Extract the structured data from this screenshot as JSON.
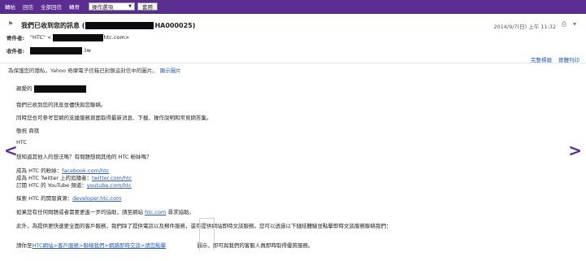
{
  "toolbar": {
    "reply": "轉帖",
    "reply_all": "回信",
    "forward_all": "全部回信",
    "forward": "轉寄",
    "actions_select": "操作選項",
    "apply": "套用"
  },
  "message": {
    "subject_prefix": "我們已收到您的訊息 (",
    "subject_suffix": "HA000025)",
    "datetime": "2014/9/7(日) 上午 11:32",
    "from_label": "寄件者:",
    "from_value_prefix": "\"HTC\" <",
    "from_value_suffix": "htc.com>",
    "to_label": "收件者:",
    "to_value_suffix": ".tw",
    "header_links": [
      "完整標頭",
      "實體列印"
    ],
    "privacy_text": "為保護您的隱私，Yahoo 奇摩電子信箱已封鎖這封信中的圖片。",
    "privacy_link": "顯示圖片"
  },
  "body": {
    "greeting": "親愛的",
    "p1": "我們已收到您的訊息並儘快與您聯絡。",
    "p2": "同時您也可參考官網的支援服務頁面取得最新消息、下載、操作說明和常見問答集。",
    "p3": "敬祝 商祺",
    "p4": "HTC",
    "p5": "想知道其他人的想法嗎？有問題想問其他的 HTC 粉絲嗎？",
    "fb_prefix": "成為 HTC 的粉絲：",
    "fb_link": "facebook.com/htc",
    "tw_prefix": "成為 HTC Twitter 上的追隨者：",
    "tw_link": "twitter.com/htc",
    "yt_prefix": "訂閱 HTC 的 YouTube 頻道：",
    "yt_link": "youtube.com/htc",
    "dev_prefix": "探索 HTC 的開發資源：",
    "dev_link": "developer.htc.com",
    "help_prefix": "如果您有任何問題或者需要更進一步的協助，請至網站",
    "help_link": "htc.com",
    "help_suffix": "尋求協助。",
    "service_text": "此外，為提供更快速更全面的客戶服務，我們除了提供電話以及郵件服務，還有提供網站即時文談服務。您可以透過以下鏈結體驗並點擊即時文談服務聯絡我們：",
    "instr_prefix": "請你至",
    "instr_link": "HTC網站>客戶服務>聯絡我們>網路即時交談>請您點擊",
    "instr_suffix": "圖示，即可與我們的客服人員即時取得優質服務。"
  }
}
